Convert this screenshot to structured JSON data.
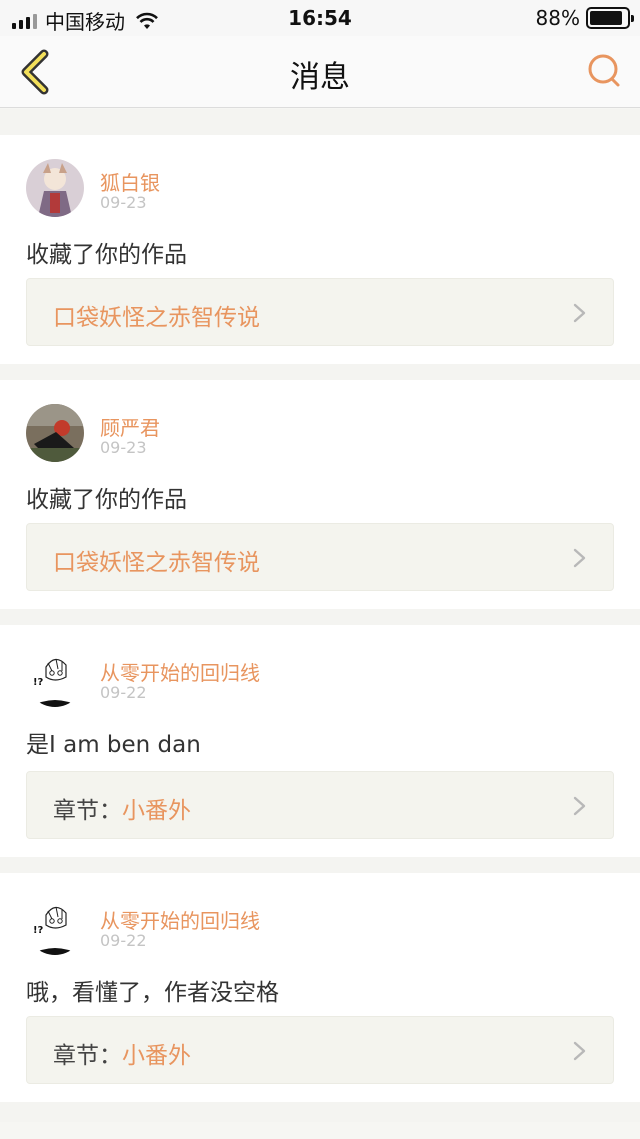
{
  "status_bar": {
    "carrier": "中国移动",
    "time": "16:54",
    "battery": "88%",
    "battery_level": 0.88
  },
  "nav": {
    "title": "消息",
    "back_icon": "chevron-left-icon",
    "search_icon": "search-icon",
    "accent_color": "#e8955f"
  },
  "messages": [
    {
      "user": "狐白银",
      "date": "09-23",
      "text": "收藏了你的作品",
      "ref_label": "",
      "ref_title": "口袋妖怪之赤智传说"
    },
    {
      "user": "顾严君",
      "date": "09-23",
      "text": "收藏了你的作品",
      "ref_label": "",
      "ref_title": "口袋妖怪之赤智传说"
    },
    {
      "user": "从零开始的回归线",
      "date": "09-22",
      "text": "是I am ben dan",
      "ref_label": "章节：",
      "ref_title": "小番外"
    },
    {
      "user": "从零开始的回归线",
      "date": "09-22",
      "text": "哦，看懂了，作者没空格",
      "ref_label": "章节：",
      "ref_title": "小番外"
    }
  ]
}
